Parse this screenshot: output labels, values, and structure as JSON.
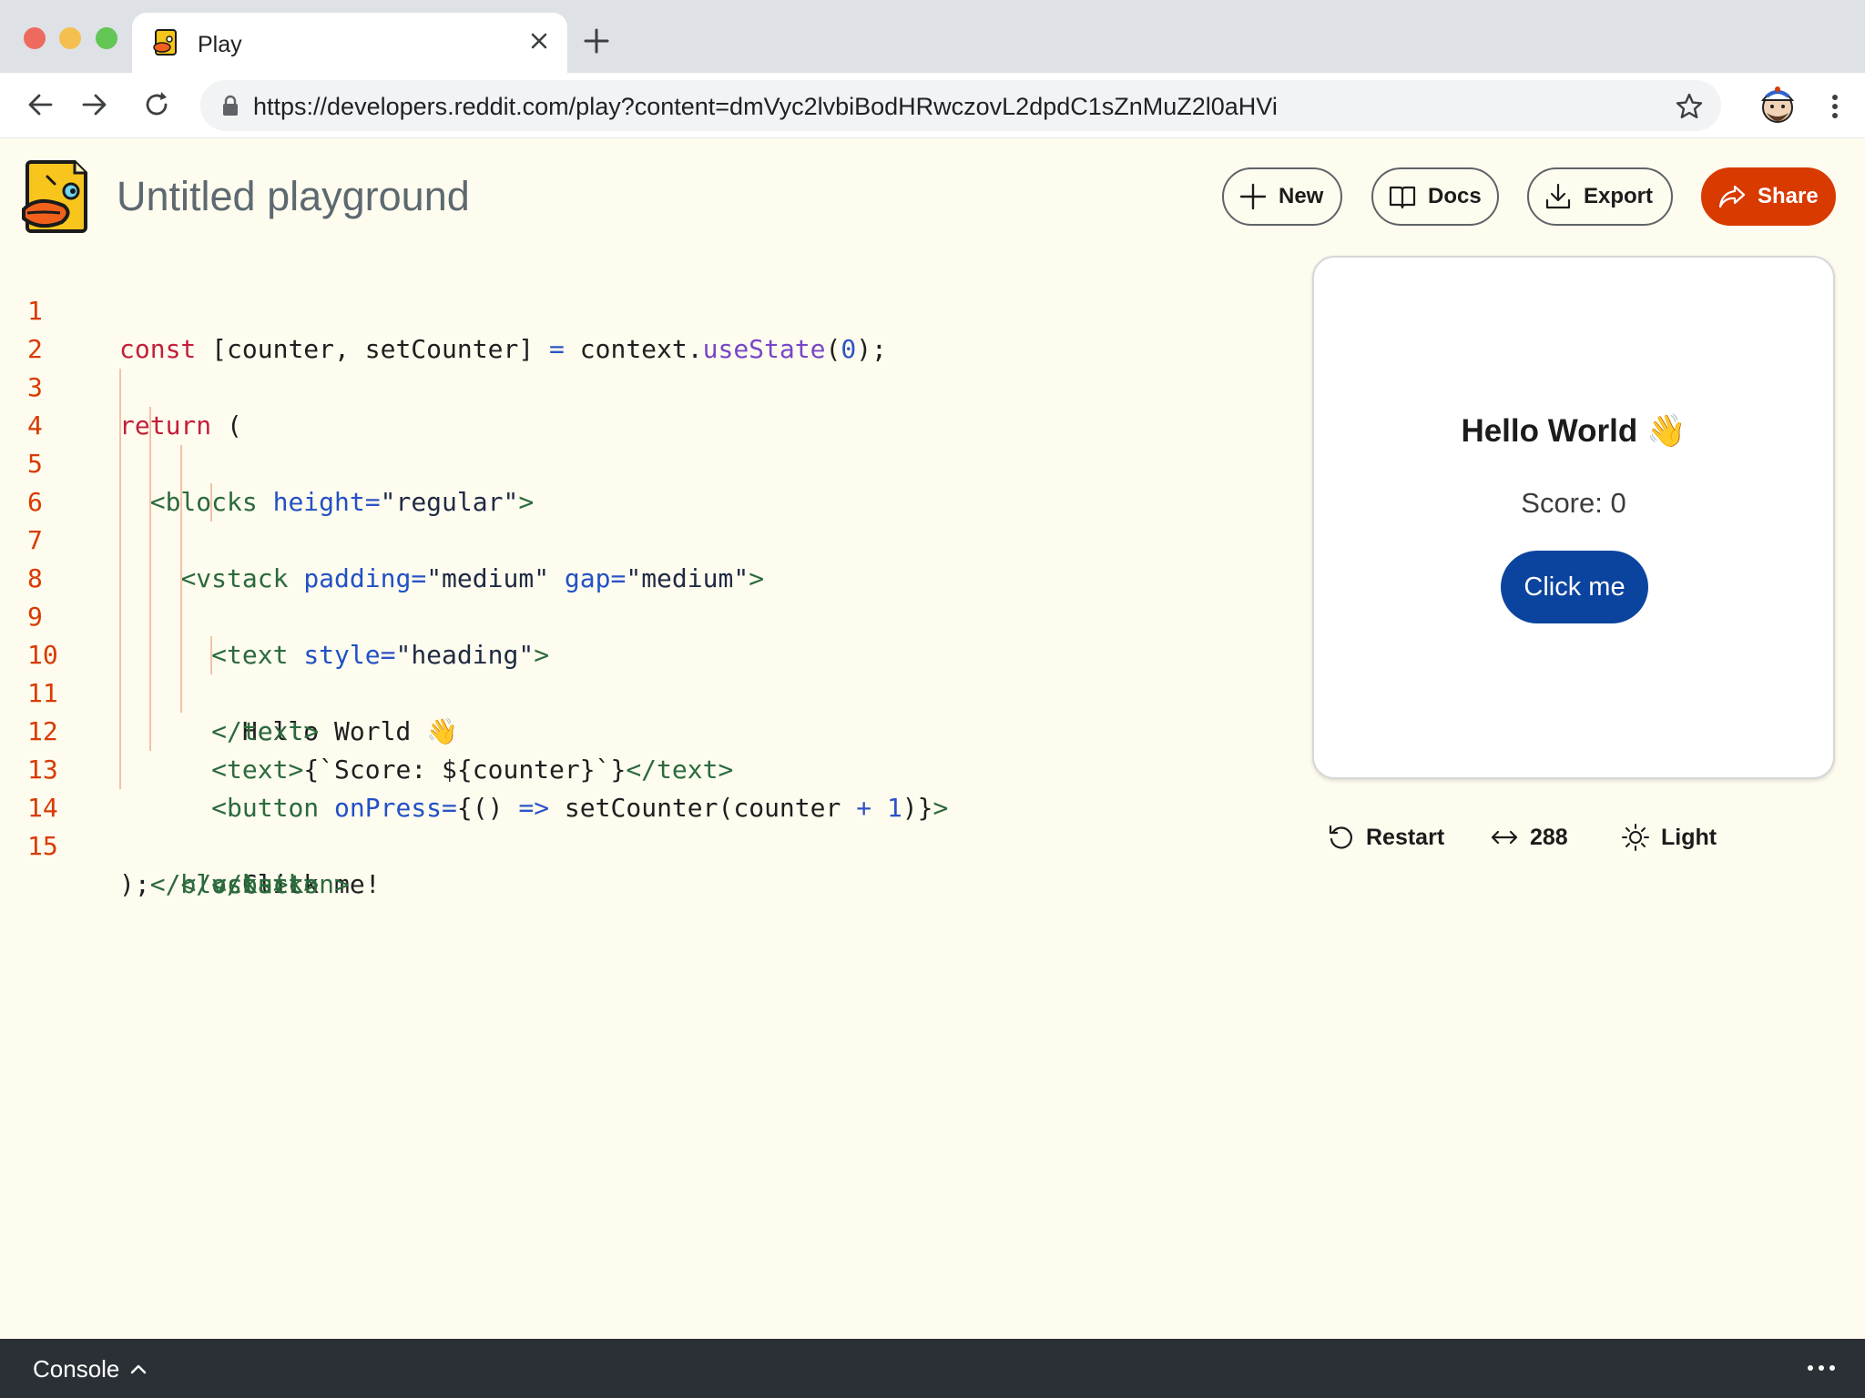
{
  "browser": {
    "tab_title": "Play",
    "url": "https://developers.reddit.com/play?content=dmVyc2lvbiBodHRwczovL2dpdC1sZnMuZ2l0aHVi"
  },
  "header": {
    "title": "Untitled playground",
    "buttons": {
      "new": "New",
      "docs": "Docs",
      "export": "Export",
      "share": "Share"
    }
  },
  "editor": {
    "line_numbers": [
      "1",
      "2",
      "3",
      "4",
      "5",
      "6",
      "7",
      "8",
      "9",
      "10",
      "11",
      "12",
      "13",
      "14",
      "15"
    ],
    "lines": [
      "const [counter, setCounter] = context.useState(0);",
      "",
      "return (",
      "  <blocks height=\"regular\">",
      "    <vstack padding=\"medium\" gap=\"medium\">",
      "      <text style=\"heading\">",
      "        Hello World 👋",
      "      </text>",
      "      <text>{`Score: ${counter}`}</text>",
      "      <button onPress={() => setCounter(counter + 1)}>",
      "        Click me!",
      "      </button>",
      "    </vstack>",
      "  </blocks>",
      ");"
    ]
  },
  "preview": {
    "heading": "Hello World 👋",
    "score": "Score: 0",
    "button": "Click me"
  },
  "controls": {
    "restart": "Restart",
    "width": "288",
    "theme": "Light"
  },
  "console": {
    "label": "Console"
  },
  "colors": {
    "accent": "#d93a00",
    "preview_button": "#0b449e",
    "background": "#fefcee",
    "console_bar": "#2a3035"
  }
}
